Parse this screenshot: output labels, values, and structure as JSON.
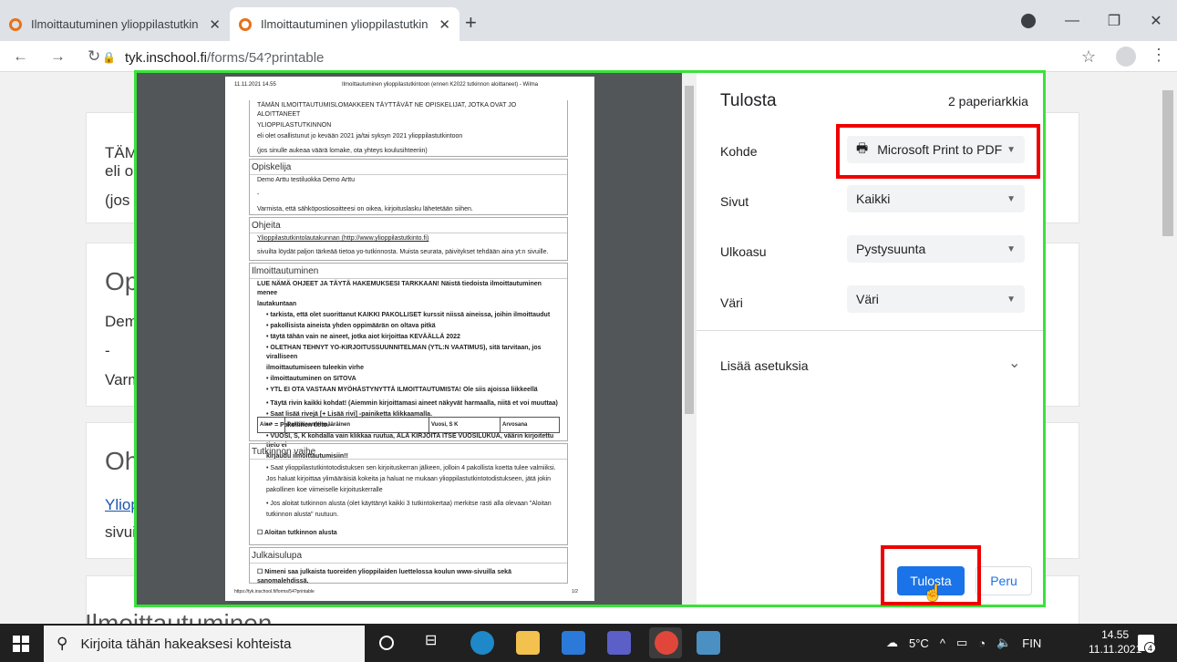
{
  "browser": {
    "tabs": [
      {
        "label": "Ilmoittautuminen ylioppilastutkin",
        "active": false
      },
      {
        "label": "Ilmoittautuminen ylioppilastutkin",
        "active": true
      }
    ],
    "url_host": "tyk.inschool.fi",
    "url_path": "/forms/54?printable"
  },
  "background": {
    "card1_lines": [
      "TÄM",
      "eli ol",
      "(jos s"
    ],
    "card2_title": "Op",
    "card2_lines": [
      "Dem",
      "-",
      "Varm"
    ],
    "card3_title": "Oh",
    "card3_link": "Yliop",
    "card3_line": "sivui",
    "card4_title": "Ilmoittautuminen"
  },
  "preview": {
    "header_date": "11.11.2021 14.55",
    "header_title": "Ilmoittautuminen ylioppilastutkintoon (ennen K2022 tutkinnon aloittaneet) - Wilma",
    "intro": [
      "TÄMÄN ILMOITTAUTUMISLOMAKKEEN TÄYTTÄVÄT NE OPISKELIJAT, JOTKA OVAT JO ALOITTANEET",
      "YLIOPPILASTUTKINNON",
      "eli olet osallistunut jo kevään 2021 ja/tai syksyn 2021 ylioppilastutkintoon",
      "(jos sinulle aukeaa väärä lomake, ota yhteys koulusihteeriin)"
    ],
    "opiskelija_title": "Opiskelija",
    "opiskelija_lines": [
      "Demo Arttu testiluokka                Demo Arttu",
      "-",
      "Varmista, että sähköpostiosoitteesi on oikea, kirjoituslasku lähetetään siihen."
    ],
    "ohjeita_title": "Ohjeita",
    "ohjeita_lines": [
      "Ylioppilastutkintolautakunnan (http://www.ylioppilastutkinto.fi)",
      "sivuilta löydät paljon tärkeää tietoa yo-tutkinnosta. Muista seurata, päivitykset tehdään aina yt:n sivuille."
    ],
    "ilm_title": "Ilmoittautuminen",
    "ilm_lines": [
      "LUE NÄMÄ OHJEET JA TÄYTÄ HAKEMUKSESI TARKKAAN! Näistä tiedoista ilmoittautuminen menee",
      "lautakuntaan",
      "• tarkista, että olet suorittanut KAIKKI PAKOLLISET kurssit niissä aineissa, joihin ilmoittaudut",
      "• pakollisista aineista yhden oppimäärän on oltava pitkä",
      "• täytä tähän vain ne aineet, jotka aiot kirjoittaa KEVÄÄLLÄ 2022",
      "• OLETHAN TEHNYT YO-KIRJOITUSSUUNNITELMAN (YTL:N VAATIMUS), sitä tarvitaan, jos viralliseen",
      "  ilmoittautumiseen tuleekin virhe",
      "• ilmoittautuminen on SITOVA",
      "• YTL EI OTA VASTAAN MYÖHÄSTYNYTTÄ ILMOITTAUTUMISTA! Ole siis ajoissa liikkeellä",
      "• Täytä rivin kaikki kohdat! (Aiemmin kirjoittamasi aineet näkyvät harmaalla, niitä et voi muuttaa)",
      "• Saat lisää rivejä [+ Lisää rivi] -painiketta klikkaamalla.",
      "• * = Pakollinen tieto.",
      "• VUOSI, S, K kohdalla vain klikkaa ruutua, ÄLÄ KIRJOITA ITSE VUOSILUKUA, väärin kirjoitettu tieto ei",
      "  kirjaudu ilmoittautumisiin!!"
    ],
    "table_headers": [
      "Aine",
      "Pakollinen/Ylimääräinen",
      "Vuosi, S K",
      "Arvosana"
    ],
    "tv_title": "Tutkinnon vaihe",
    "tv_lines": [
      "• Saat ylioppilastutkintotodistuksen sen kirjoituskerran jälkeen, jolloin 4 pakollista koetta tulee valmiiksi.",
      "  Jos haluat kirjoittaa ylimääräisiä kokeita ja haluat ne mukaan ylioppilastutkintotodistukseen, jätä jokin",
      "  pakollinen koe viimeiselle kirjoituskerralle",
      "• Jos aloitat tutkinnon alusta (olet käyttänyt kaikki 3 tutkintokertaa) merkitse rasti alla olevaan \"Aloitan",
      "  tutkinnon alusta\" ruutuun.",
      "☐  Aloitan tutkinnon alusta"
    ],
    "jl_title": "Julkaisulupa",
    "jl_line": "☐  Nimeni saa julkaista tuoreiden ylioppilaiden luettelossa koulun www-sivuilla sekä sanomalehdissä.",
    "footer_url": "https://tyk.inschool.fi/forms/54?printable",
    "footer_page": "1/2"
  },
  "print": {
    "title": "Tulosta",
    "sheets": "2 paperiarkkia",
    "kohde_label": "Kohde",
    "kohde_value": "Microsoft Print to PDF",
    "sivut_label": "Sivut",
    "sivut_value": "Kaikki",
    "ulkoasu_label": "Ulkoasu",
    "ulkoasu_value": "Pystysuunta",
    "vari_label": "Väri",
    "vari_value": "Väri",
    "more_label": "Lisää asetuksia",
    "print_button": "Tulosta",
    "cancel_button": "Peru"
  },
  "taskbar": {
    "search_placeholder": "Kirjoita tähän hakeaksesi kohteista",
    "weather": "5°C",
    "lang": "FIN",
    "time": "14.55",
    "date": "11.11.2021",
    "notif_count": "4"
  }
}
